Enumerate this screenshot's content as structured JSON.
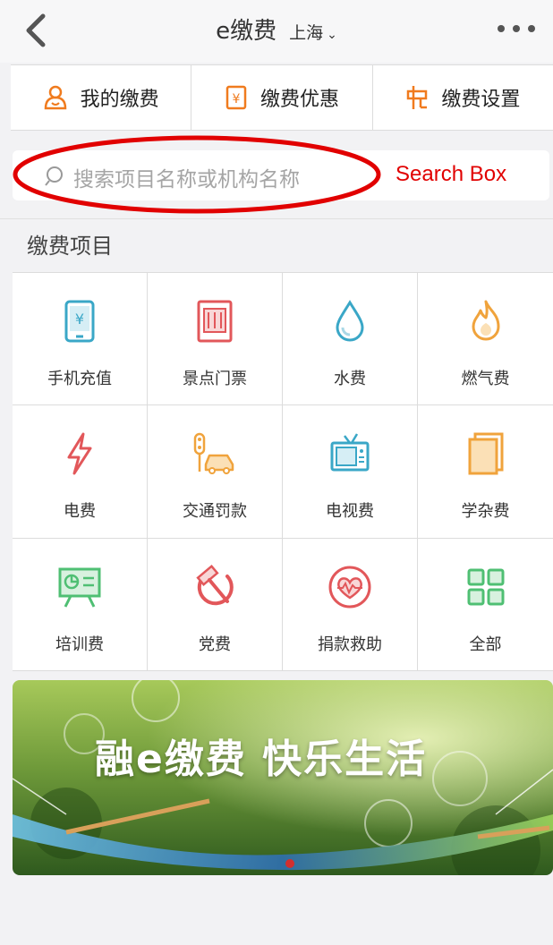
{
  "header": {
    "title": "e缴费",
    "city": "上海",
    "city_chevron": "⌄"
  },
  "quick_tabs": [
    {
      "label": "我的缴费",
      "icon": "person-icon"
    },
    {
      "label": "缴费优惠",
      "icon": "coupon-icon"
    },
    {
      "label": "缴费设置",
      "icon": "settings-icon"
    }
  ],
  "search": {
    "placeholder": "搜索项目名称或机构名称",
    "annotation_label": "Search Box"
  },
  "section": {
    "title": "缴费项目"
  },
  "items": [
    {
      "label": "手机充值",
      "icon": "phone-topup-icon",
      "color": "#3aa7c7"
    },
    {
      "label": "景点门票",
      "icon": "ticket-icon",
      "color": "#e2575a"
    },
    {
      "label": "水费",
      "icon": "water-drop-icon",
      "color": "#3aa7c7"
    },
    {
      "label": "燃气费",
      "icon": "flame-icon",
      "color": "#f0a33c"
    },
    {
      "label": "电费",
      "icon": "lightning-icon",
      "color": "#e2575a"
    },
    {
      "label": "交通罚款",
      "icon": "traffic-car-icon",
      "color": "#f0a33c"
    },
    {
      "label": "电视费",
      "icon": "tv-icon",
      "color": "#3aa7c7"
    },
    {
      "label": "学杂费",
      "icon": "book-icon",
      "color": "#f0a33c"
    },
    {
      "label": "培训费",
      "icon": "presentation-icon",
      "color": "#4fbf73"
    },
    {
      "label": "党费",
      "icon": "hammer-sickle-icon",
      "color": "#e2575a"
    },
    {
      "label": "捐款救助",
      "icon": "heart-icon",
      "color": "#e2575a"
    },
    {
      "label": "全部",
      "icon": "grid-all-icon",
      "color": "#4fbf73"
    }
  ],
  "banner": {
    "text": "融e缴费 快乐生活"
  },
  "colors": {
    "accent_red": "#e10000",
    "background": "#f2f2f4"
  }
}
